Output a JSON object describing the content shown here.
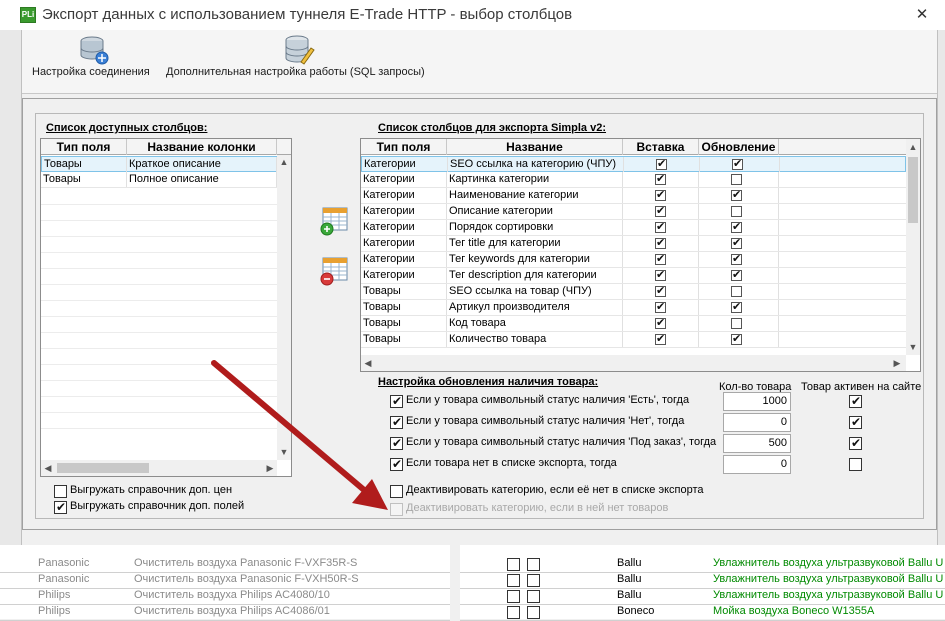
{
  "window": {
    "title": "Экспорт данных с использованием туннеля E-Trade HTTP - выбор столбцов",
    "app_icon": "PLi",
    "close": "✕"
  },
  "toolbar": {
    "connection_label": "Настройка соединения",
    "sql_label": "Дополнительная настройка работы (SQL запросы)"
  },
  "available": {
    "title": "Список доступных столбцов:",
    "headers": [
      "Тип поля",
      "Название колонки"
    ],
    "rows": [
      {
        "type": "Товары",
        "name": "Краткое описание"
      },
      {
        "type": "Товары",
        "name": "Полное описание"
      }
    ]
  },
  "export_list": {
    "title": "Список столбцов для экспорта Simpla v2:",
    "headers": [
      "Тип поля",
      "Название",
      "Вставка",
      "Обновление"
    ],
    "rows": [
      {
        "type": "Категории",
        "name": "SEO ссылка на категорию (ЧПУ)",
        "insert": true,
        "update": true
      },
      {
        "type": "Категории",
        "name": "Картинка категории",
        "insert": true,
        "update": false
      },
      {
        "type": "Категории",
        "name": "Наименование категории",
        "insert": true,
        "update": true
      },
      {
        "type": "Категории",
        "name": "Описание категории",
        "insert": true,
        "update": false
      },
      {
        "type": "Категории",
        "name": "Порядок сортировки",
        "insert": true,
        "update": true
      },
      {
        "type": "Категории",
        "name": "Тег title для категории",
        "insert": true,
        "update": true
      },
      {
        "type": "Категории",
        "name": "Тег keywords для категории",
        "insert": true,
        "update": true
      },
      {
        "type": "Категории",
        "name": "Тег description для категории",
        "insert": true,
        "update": true
      },
      {
        "type": "Товары",
        "name": "SEO ссылка на товар (ЧПУ)",
        "insert": true,
        "update": false
      },
      {
        "type": "Товары",
        "name": "Артикул производителя",
        "insert": true,
        "update": true
      },
      {
        "type": "Товары",
        "name": "Код товара",
        "insert": true,
        "update": false
      },
      {
        "type": "Товары",
        "name": "Количество товара",
        "insert": true,
        "update": true
      }
    ]
  },
  "stock_settings": {
    "title": "Настройка обновления наличия товара:",
    "qty_header": "Кол-во товара",
    "active_header": "Товар активен на сайте",
    "rules": [
      {
        "label": "Если у товара символьный статус наличия 'Есть', тогда",
        "checked": true,
        "qty": "1000",
        "active": true
      },
      {
        "label": "Если у товара символьный статус наличия 'Нет', тогда",
        "checked": true,
        "qty": "0",
        "active": true
      },
      {
        "label": "Если у товара символьный статус наличия 'Под заказ', тогда",
        "checked": true,
        "qty": "500",
        "active": true
      },
      {
        "label": "Если товара нет в списке экспорта, тогда",
        "checked": true,
        "qty": "0",
        "active": false
      }
    ],
    "deactivate_missing": {
      "label": "Деактивировать категорию, если её нет в списке экспорта",
      "checked": false
    },
    "deactivate_empty": {
      "label": "Деактивировать категорию, если в ней нет товаров",
      "checked": false
    }
  },
  "bottom_options": {
    "export_prices": {
      "label": "Выгружать справочник доп. цен",
      "checked": false
    },
    "export_fields": {
      "label": "Выгружать справочник доп. полей",
      "checked": true
    }
  },
  "background": {
    "left_rows": [
      {
        "brand": "Panasonic",
        "name": "Очиститель воздуха Panasonic F-VXF35R-S"
      },
      {
        "brand": "Panasonic",
        "name": "Очиститель воздуха Panasonic F-VXH50R-S"
      },
      {
        "brand": "Philips",
        "name": "Очиститель воздуха Philips AC4080/10"
      },
      {
        "brand": "Philips",
        "name": "Очиститель воздуха Philips AC4086/01"
      }
    ],
    "right_rows": [
      {
        "brand": "Ballu",
        "name": "Увлажнитель воздуха ультразвуковой Ballu U"
      },
      {
        "brand": "Ballu",
        "name": "Увлажнитель воздуха ультразвуковой Ballu U"
      },
      {
        "brand": "Ballu",
        "name": "Увлажнитель воздуха ультразвуковой Ballu U"
      },
      {
        "brand": "Boneco",
        "name": "Мойка воздуха Boneco W1355A"
      }
    ]
  },
  "colors": {
    "arrow": "#b01c1c",
    "selection": "#e5f3fb",
    "green_text": "#008a00"
  }
}
